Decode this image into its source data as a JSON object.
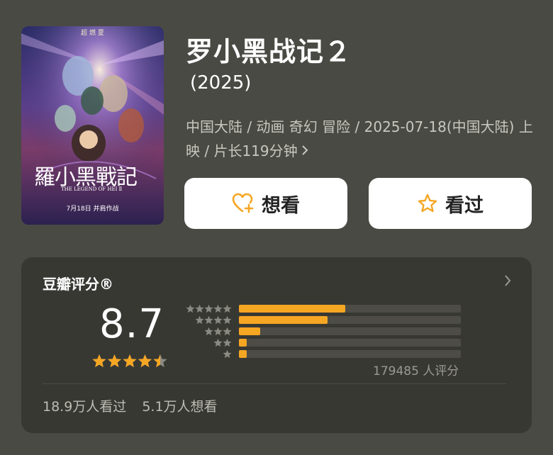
{
  "poster": {
    "top_text": "超 燃 夏",
    "calligraphy_title": "羅小黑戰記",
    "subtitle_en": "THE LEGEND OF HEI Ⅱ",
    "release_line": "7月18日 并肩作战"
  },
  "movie": {
    "title": "罗小黑战记２",
    "year": "(2025)",
    "meta": "中国大陆 / 动画 奇幻 冒险 / 2025-07-18(中国大陆) 上映 / 片长119分钟"
  },
  "actions": {
    "want_label": "想看",
    "seen_label": "看过"
  },
  "rating": {
    "header": "豆瓣评分®",
    "score": "8.7",
    "score_stars": 4.5,
    "distribution": [
      {
        "stars": 5,
        "fraction": 0.48
      },
      {
        "stars": 4,
        "fraction": 0.4
      },
      {
        "stars": 3,
        "fraction": 0.095
      },
      {
        "stars": 2,
        "fraction": 0.035
      },
      {
        "stars": 1,
        "fraction": 0.035
      }
    ],
    "count_text": "179485 人评分",
    "watched_text": "18.9万人看过",
    "want_text": "5.1万人想看"
  },
  "colors": {
    "background": "#4a4a44",
    "card": "#383833",
    "accent": "#f5a623",
    "button_bg": "#ffffff"
  },
  "icons": {
    "want": "heart-plus-icon",
    "seen": "star-outline-icon",
    "meta_more": "chevron-right-icon",
    "rating_more": "chevron-right-icon"
  }
}
